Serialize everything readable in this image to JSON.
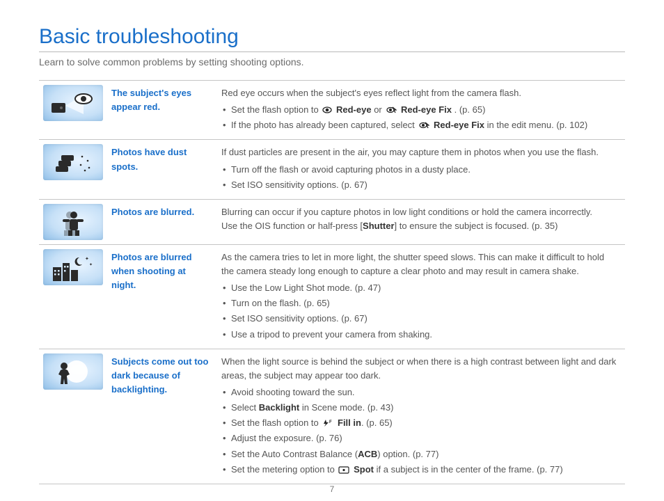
{
  "page": {
    "title": "Basic troubleshooting",
    "lead": "Learn to solve common problems by setting shooting options.",
    "number": "7"
  },
  "rows": [
    {
      "problem": "The subject's eyes appear red.",
      "intro": "Red eye occurs when the subject's eyes reflect light from the camera flash.",
      "b1_a": "Set the flash option to ",
      "b1_bold1": "Red-eye",
      "b1_mid": " or ",
      "b1_bold2": "Red-eye Fix",
      "b1_z": ". (p. 65)",
      "b2_a": "If the photo has already been captured, select ",
      "b2_bold": "Red-eye Fix",
      "b2_z": " in the edit menu. (p. 102)"
    },
    {
      "problem": "Photos have dust spots.",
      "intro": "If dust particles are present in the air, you may capture them in photos when you use the flash.",
      "b1": "Turn off the flash or avoid capturing photos in a dusty place.",
      "b2": "Set ISO sensitivity options. (p. 67)"
    },
    {
      "problem": "Photos are blurred.",
      "l1": "Blurring can occur if you capture photos in low light conditions or hold the camera incorrectly.",
      "l2_a": "Use the OIS function or half-press [",
      "l2_bold": "Shutter",
      "l2_z": "] to ensure the subject is focused. (p. 35)"
    },
    {
      "problem": "Photos are blurred when shooting at night.",
      "intro": "As the camera tries to let in more light, the shutter speed slows. This can make it difficult to hold the camera steady long enough to capture a clear photo and may result in camera shake.",
      "b1": "Use the Low Light Shot mode. (p. 47)",
      "b2": "Turn on the flash. (p. 65)",
      "b3": "Set ISO sensitivity options. (p. 67)",
      "b4": "Use a tripod to prevent your camera from shaking."
    },
    {
      "problem": "Subjects come out too dark because of backlighting.",
      "intro": "When the light source is behind the subject or when there is a high contrast between light and dark areas, the subject may appear too dark.",
      "b1": "Avoid shooting toward the sun.",
      "b2_a": "Select ",
      "b2_bold": "Backlight",
      "b2_z": " in Scene mode. (p. 43)",
      "b3_a": "Set the flash option to ",
      "b3_bold": "Fill in",
      "b3_z": ". (p. 65)",
      "b4": "Adjust the exposure. (p. 76)",
      "b5_a": "Set the Auto Contrast Balance (",
      "b5_bold": "ACB",
      "b5_z": ") option. (p. 77)",
      "b6_a": "Set the metering option to ",
      "b6_bold": "Spot",
      "b6_z": " if a subject is in the center of the frame. (p. 77)"
    }
  ]
}
